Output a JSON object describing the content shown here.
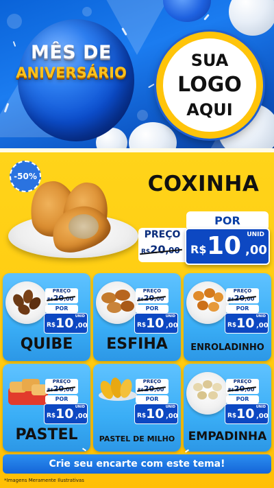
{
  "hero": {
    "title_line1": "MÊS DE",
    "title_line2": "ANIVERSÁRIO",
    "logo_line1": "SUA",
    "logo_line2": "LOGO",
    "logo_line3": "AQUI"
  },
  "featured": {
    "discount": "-50%",
    "name": "COXINHA",
    "preco_label": "PREÇO",
    "old_currency": "R$",
    "old_int": "20",
    "old_cents": ",00",
    "por_label": "POR",
    "currency": "R$",
    "price_int": "10",
    "price_cents": ",00",
    "unit": "UNID"
  },
  "products": [
    {
      "name": "QUIBE",
      "preco_label": "PREÇO",
      "old_currency": "R$",
      "old_int": "20",
      "old_cents": ",00",
      "por_label": "POR",
      "currency": "R$",
      "price_int": "10",
      "price_cents": ",00",
      "unit": "UNID"
    },
    {
      "name": "ESFIHA",
      "preco_label": "PREÇO",
      "old_currency": "R$",
      "old_int": "20",
      "old_cents": ",00",
      "por_label": "POR",
      "currency": "R$",
      "price_int": "10",
      "price_cents": ",00",
      "unit": "UNID"
    },
    {
      "name": "ENROLADINHO",
      "preco_label": "PREÇO",
      "old_currency": "R$",
      "old_int": "20",
      "old_cents": ",00",
      "por_label": "POR",
      "currency": "R$",
      "price_int": "10",
      "price_cents": ",00",
      "unit": "UNID"
    },
    {
      "name": "PASTEL",
      "preco_label": "PREÇO",
      "old_currency": "R$",
      "old_int": "20",
      "old_cents": ",00",
      "por_label": "POR",
      "currency": "R$",
      "price_int": "10",
      "price_cents": ",00",
      "unit": "UNID"
    },
    {
      "name": "PASTEL DE MILHO",
      "preco_label": "PREÇO",
      "old_currency": "R$",
      "old_int": "20",
      "old_cents": ",00",
      "por_label": "POR",
      "currency": "R$",
      "price_int": "10",
      "price_cents": ",00",
      "unit": "UNID"
    },
    {
      "name": "EMPADINHA",
      "preco_label": "PREÇO",
      "old_currency": "R$",
      "old_int": "20",
      "old_cents": ",00",
      "por_label": "POR",
      "currency": "R$",
      "price_int": "10",
      "price_cents": ",00",
      "unit": "UNID"
    }
  ],
  "cta": {
    "label": "Crie seu encarte com este tema!"
  },
  "footer": {
    "note": "*Imagens Meramente Ilustrativas"
  },
  "colors": {
    "blue": "#0d48c2",
    "yellow": "#ffcb10",
    "card": "#3aaef6",
    "logo_ring": "#ffc40a"
  },
  "icons": {
    "discount": "discount-badge",
    "images": [
      "food-coxinha-image",
      "food-quibe-image",
      "food-esfiha-image",
      "food-enroladinho-image",
      "food-pastel-image",
      "food-pastel-de-milho-image",
      "food-empadinha-image"
    ]
  }
}
